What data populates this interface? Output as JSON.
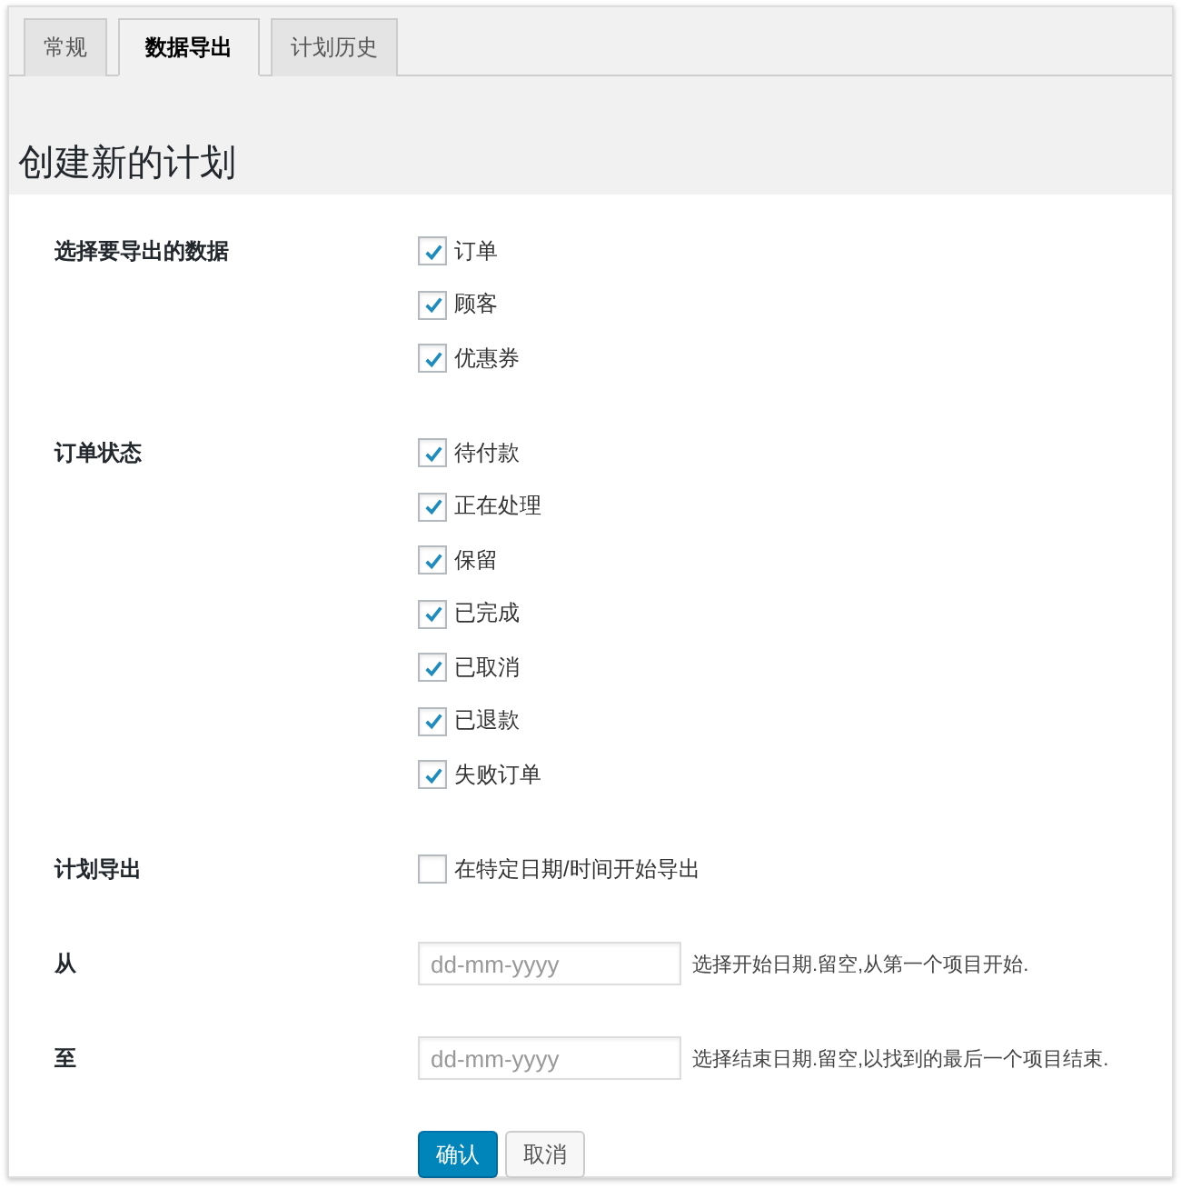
{
  "tabs": [
    {
      "label": "常规",
      "selected": false
    },
    {
      "label": "数据导出",
      "selected": true
    },
    {
      "label": "计划历史",
      "selected": false
    }
  ],
  "heading": "创建新的计划",
  "fields": [
    {
      "kind": "checklist",
      "label": "选择要导出的数据",
      "options": [
        {
          "label": "订单",
          "checked": true
        },
        {
          "label": "顾客",
          "checked": true
        },
        {
          "label": "优惠券",
          "checked": true
        }
      ]
    },
    {
      "kind": "checklist",
      "label": "订单状态",
      "options": [
        {
          "label": "待付款",
          "checked": true
        },
        {
          "label": "正在处理",
          "checked": true
        },
        {
          "label": "保留",
          "checked": true
        },
        {
          "label": "已完成",
          "checked": true
        },
        {
          "label": "已取消",
          "checked": true
        },
        {
          "label": "已退款",
          "checked": true
        },
        {
          "label": "失败订单",
          "checked": true
        }
      ]
    },
    {
      "kind": "checklist",
      "label": "计划导出",
      "options": [
        {
          "label": "在特定日期/时间开始导出",
          "checked": false
        }
      ]
    },
    {
      "kind": "date",
      "label": "从",
      "placeholder": "dd-mm-yyyy",
      "description": "选择开始日期.留空,从第一个项目开始."
    },
    {
      "kind": "date",
      "label": "至",
      "placeholder": "dd-mm-yyyy",
      "description": "选择结束日期.留空,以找到的最后一个项目结束."
    }
  ],
  "buttons": [
    {
      "label": "确认",
      "kind": "primary"
    },
    {
      "label": "取消",
      "kind": "secondary"
    }
  ]
}
